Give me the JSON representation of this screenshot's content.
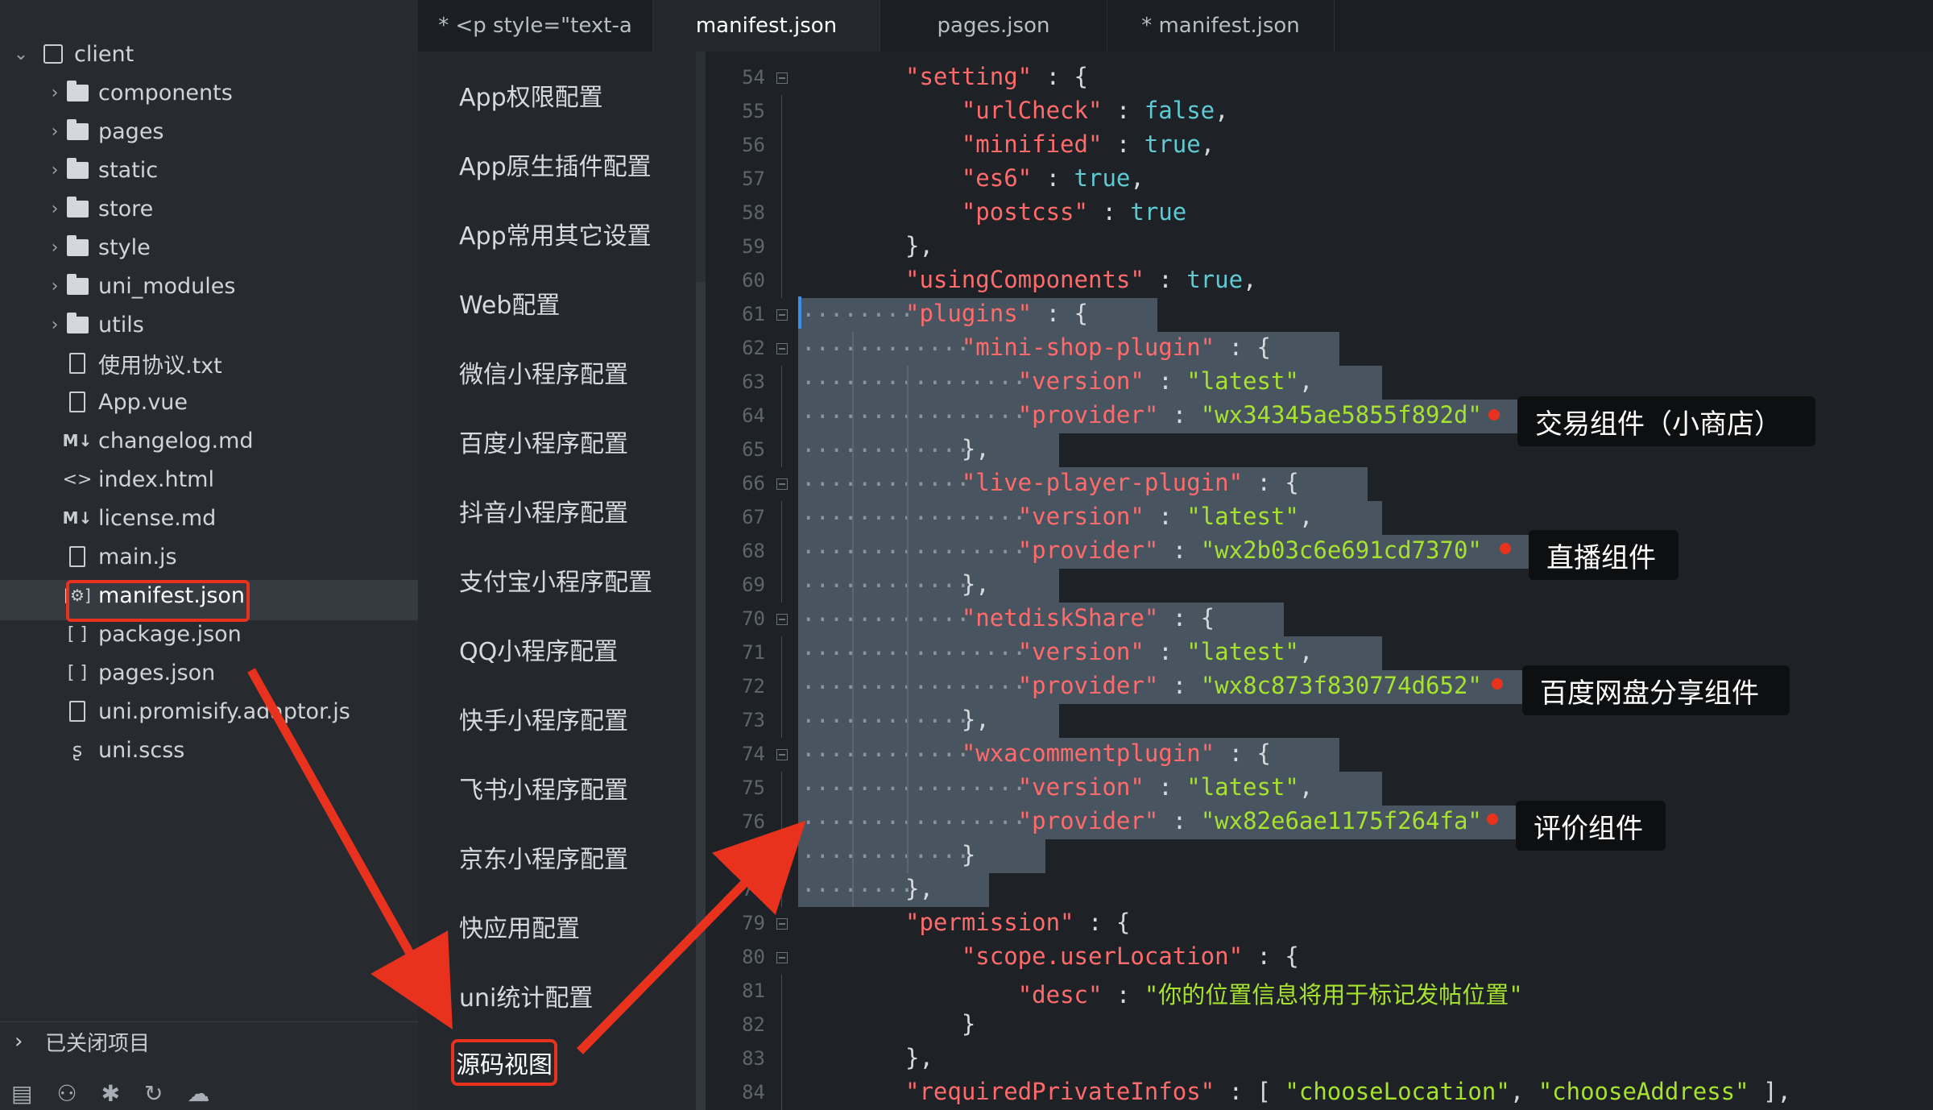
{
  "sidebar": {
    "root": "client",
    "items": [
      {
        "label": "components",
        "type": "folder"
      },
      {
        "label": "pages",
        "type": "folder"
      },
      {
        "label": "static",
        "type": "folder"
      },
      {
        "label": "store",
        "type": "folder"
      },
      {
        "label": "style",
        "type": "folder"
      },
      {
        "label": "uni_modules",
        "type": "folder"
      },
      {
        "label": "utils",
        "type": "folder"
      },
      {
        "label": "使用协议.txt",
        "type": "file"
      },
      {
        "label": "App.vue",
        "type": "file"
      },
      {
        "label": "changelog.md",
        "type": "md"
      },
      {
        "label": "index.html",
        "type": "html"
      },
      {
        "label": "license.md",
        "type": "md"
      },
      {
        "label": "main.js",
        "type": "file"
      },
      {
        "label": "manifest.json",
        "type": "json-gear",
        "selected": true
      },
      {
        "label": "package.json",
        "type": "json"
      },
      {
        "label": "pages.json",
        "type": "json"
      },
      {
        "label": "uni.promisify.adaptor.js",
        "type": "file"
      },
      {
        "label": "uni.scss",
        "type": "scss"
      }
    ],
    "closed_projects": "已关闭项目"
  },
  "tabs": [
    {
      "label": "* <p style=\"text-a"
    },
    {
      "label": "manifest.json",
      "active": true
    },
    {
      "label": "pages.json"
    },
    {
      "label": "* manifest.json"
    }
  ],
  "settings_nav": [
    "App权限配置",
    "App原生插件配置",
    "App常用其它设置",
    "Web配置",
    "微信小程序配置",
    "百度小程序配置",
    "抖音小程序配置",
    "支付宝小程序配置",
    "QQ小程序配置",
    "快手小程序配置",
    "飞书小程序配置",
    "京东小程序配置",
    "快应用配置",
    "uni统计配置",
    "源码视图"
  ],
  "editor": {
    "line_numbers": [
      "54",
      "55",
      "56",
      "57",
      "58",
      "59",
      "60",
      "61",
      "62",
      "63",
      "64",
      "65",
      "66",
      "67",
      "68",
      "69",
      "70",
      "71",
      "72",
      "73",
      "74",
      "75",
      "76",
      "77",
      "78",
      "79",
      "80",
      "81",
      "82",
      "83",
      "84"
    ],
    "lines": [
      "\"setting\" : {",
      "    \"urlCheck\" : false,",
      "    \"minified\" : true,",
      "    \"es6\" : true,",
      "    \"postcss\" : true",
      "},",
      "\"usingComponents\" : true,",
      "\"plugins\" : {",
      "    \"mini-shop-plugin\" : {",
      "        \"version\" : \"latest\",",
      "        \"provider\" : \"wx34345ae5855f892d\"",
      "    },",
      "    \"live-player-plugin\" : {",
      "        \"version\" : \"latest\",",
      "        \"provider\" : \"wx2b03c6e691cd7370\"",
      "    },",
      "    \"netdiskShare\" : {",
      "        \"version\" : \"latest\",",
      "        \"provider\" : \"wx8c873f830774d652\"",
      "    },",
      "    \"wxacommentplugin\" : {",
      "        \"version\" : \"latest\",",
      "        \"provider\" : \"wx82e6ae1175f264fa\"",
      "    }",
      "},",
      "\"permission\" : {",
      "    \"scope.userLocation\" : {",
      "        \"desc\" : \"你的位置信息将用于标记发帖位置\"",
      "    }",
      "},",
      "\"requiredPrivateInfos\" : [ \"chooseLocation\", \"chooseAddress\" ],"
    ]
  },
  "callouts": [
    "交易组件（小商店）",
    "直播组件",
    "百度网盘分享组件",
    "评价组件"
  ],
  "colors": {
    "key": "#ff6b6b",
    "string": "#a6e22e",
    "boolean": "#5ecbd4",
    "highlight": "#e8321e",
    "selection": "#485460"
  }
}
